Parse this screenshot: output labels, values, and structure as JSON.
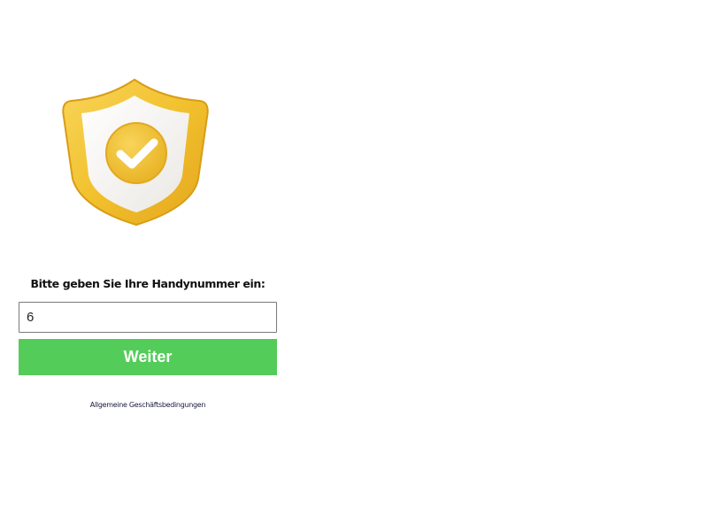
{
  "icon": {
    "name": "shield-check-icon",
    "gold": "#f2c12e",
    "gold_dark": "#e0a91f",
    "inner": "#f3f1ee"
  },
  "form": {
    "prompt": "Bitte geben Sie Ihre Handynummer ein:",
    "phone_value": "6",
    "submit_label": "Weiter",
    "submit_color": "#54cc5a"
  },
  "footer": {
    "terms_label": "Allgemeine Geschäftsbedingungen"
  }
}
